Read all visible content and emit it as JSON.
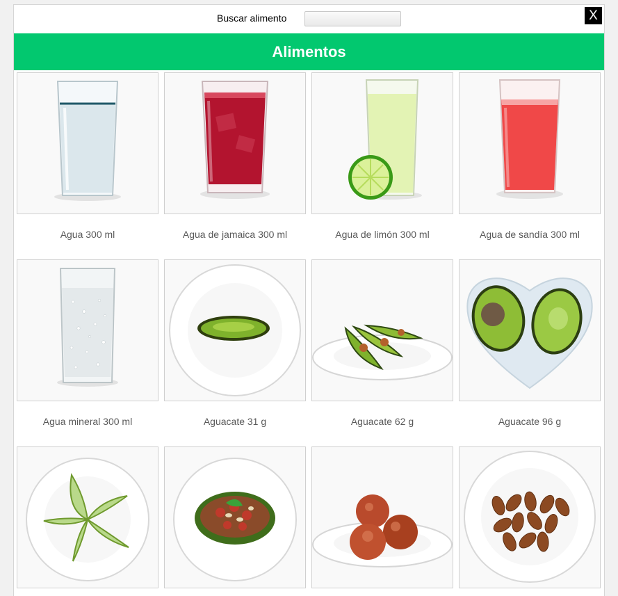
{
  "search": {
    "label": "Buscar alimento",
    "value": ""
  },
  "close_label": "X",
  "header": {
    "title": "Alimentos"
  },
  "foods": [
    {
      "name": "Agua 300 ml",
      "icon": "water-glass-icon"
    },
    {
      "name": "Agua de jamaica 300 ml",
      "icon": "hibiscus-water-glass-icon"
    },
    {
      "name": "Agua de limón 300 ml",
      "icon": "lime-water-glass-icon"
    },
    {
      "name": "Agua de sandía 300 ml",
      "icon": "watermelon-water-glass-icon"
    },
    {
      "name": "Agua mineral 300 ml",
      "icon": "sparkling-water-glass-icon"
    },
    {
      "name": "Aguacate 31 g",
      "icon": "avocado-slice-plate-icon"
    },
    {
      "name": "Aguacate 62 g",
      "icon": "avocado-wedges-plate-icon"
    },
    {
      "name": "Aguacate 96 g",
      "icon": "avocado-halves-heart-plate-icon"
    },
    {
      "name": "",
      "icon": "avocado-pinwheel-plate-icon"
    },
    {
      "name": "",
      "icon": "stuffed-avocado-plate-icon"
    },
    {
      "name": "",
      "icon": "meatballs-plate-icon"
    },
    {
      "name": "",
      "icon": "almonds-plate-icon"
    }
  ],
  "colors": {
    "header_green": "#02c86f",
    "jamaica": "#b3142f",
    "lime": "#e3f3b4",
    "watermelon": "#f04848",
    "avocado": "#7fb22c"
  }
}
